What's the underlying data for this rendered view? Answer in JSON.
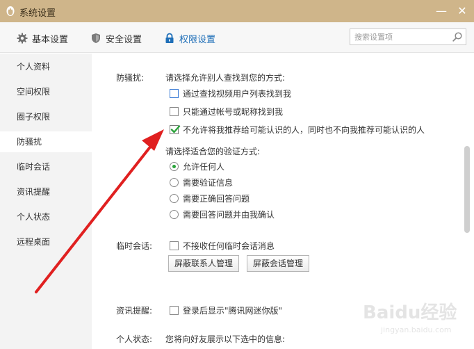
{
  "window": {
    "title": "系统设置",
    "minimize_glyph": "—",
    "close_glyph": "✕"
  },
  "toolbar": {
    "tabs": [
      {
        "label": "基本设置",
        "icon": "gear-icon"
      },
      {
        "label": "安全设置",
        "icon": "shield-icon"
      },
      {
        "label": "权限设置",
        "icon": "lock-icon"
      }
    ],
    "active_tab": "权限设置",
    "search_placeholder": "搜索设置项"
  },
  "sidebar": {
    "items": [
      "个人资料",
      "空间权限",
      "圈子权限",
      "防骚扰",
      "临时会话",
      "资讯提醒",
      "个人状态",
      "远程桌面"
    ],
    "active": "防骚扰"
  },
  "anti_harassment": {
    "label": "防骚扰:",
    "find_title": "请选择允许别人查找到您的方式:",
    "find_options": [
      {
        "label": "通过查找视频用户列表找到我",
        "checked": false
      },
      {
        "label": "只能通过帐号或昵称找到我",
        "checked": false
      },
      {
        "label": "不允许将我推荐给可能认识的人，同时也不向我推荐可能认识的人",
        "checked": true
      }
    ],
    "verify_title": "请选择适合您的验证方式:",
    "verify_options": [
      {
        "label": "允许任何人",
        "selected": true
      },
      {
        "label": "需要验证信息",
        "selected": false
      },
      {
        "label": "需要正确回答问题",
        "selected": false
      },
      {
        "label": "需要回答问题并由我确认",
        "selected": false
      }
    ]
  },
  "temp_session": {
    "label": "临时会话:",
    "option": "不接收任何临时会话消息",
    "checked": false,
    "buttons": [
      "屏蔽联系人管理",
      "屏蔽会话管理"
    ]
  },
  "news_reminder": {
    "label": "资讯提醒:",
    "option": "登录后显示\"腾讯网迷你版\"",
    "checked": false
  },
  "personal_status": {
    "label": "个人状态:",
    "text": "您将向好友展示以下选中的信息:"
  },
  "watermark": {
    "text": "Baidu经验",
    "url": "jingyan.baidu.com"
  },
  "colors": {
    "titlebar": "#cfb58a",
    "accent": "#1f6fb8",
    "arrow": "#e02020",
    "check_green": "#2aa33a"
  }
}
